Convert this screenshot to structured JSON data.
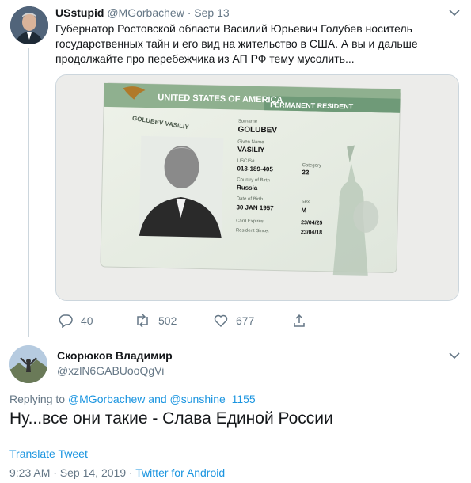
{
  "tweet1": {
    "name": "USstupid",
    "handle": "@MGorbachew",
    "separator": "·",
    "date": "Sep 13",
    "text": "Губернатор Ростовской области Василий Юрьевич Голубев носитель государственных тайн и его вид на жительство в США. А вы и дальше продолжайте про перебежчика из АП РФ тему мусолить...",
    "card": {
      "header_left": "UNITED STATES OF AMERICA",
      "header_right": "PERMANENT RESIDENT",
      "side_text": "GOLUBEV VASILIY",
      "surname_label": "Surname",
      "surname": "GOLUBEV",
      "given_label": "Given Name",
      "given": "VASILIY",
      "uscis_label": "USCIS#",
      "uscis": "013-189-405",
      "category_label": "Category",
      "category": "22",
      "country_label": "Country of Birth",
      "country": "Russia",
      "dob_label": "Date of Birth",
      "dob": "30 JAN 1957",
      "sex_label": "Sex",
      "sex": "M",
      "expires_label": "Card Expires:",
      "expires": "23/04/25",
      "since_label": "Resident Since:",
      "since": "23/04/18"
    },
    "actions": {
      "replies": "40",
      "retweets": "502",
      "likes": "677"
    }
  },
  "tweet2": {
    "name": "Скорюков Владимир",
    "handle": "@xzlN6GABUooQgVi",
    "replying_prefix": "Replying to",
    "reply_user1": "@MGorbachew",
    "and": "and",
    "reply_user2": "@sunshine_1155",
    "text": "Ну...все они такие  - Слава Единой России",
    "translate": "Translate Tweet",
    "time": "9:23 AM · Sep 14, 2019 ·",
    "source": "Twitter for Android"
  },
  "colors": {
    "link": "#1b95e0",
    "muted": "#657786",
    "text": "#14171a",
    "border": "#ccd6dd"
  }
}
